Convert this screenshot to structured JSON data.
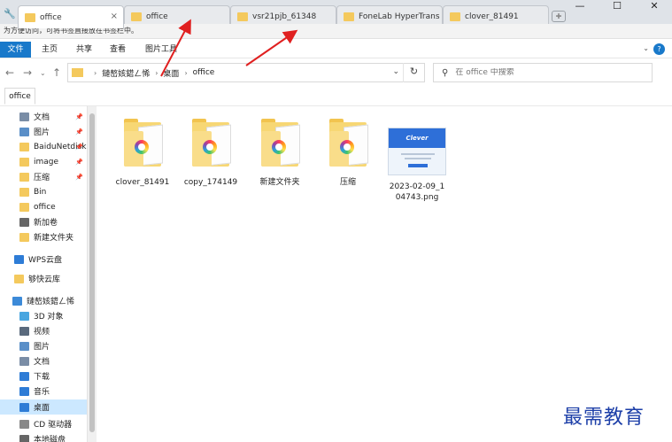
{
  "browser": {
    "tabs": [
      {
        "label": "office",
        "active": true
      },
      {
        "label": "office",
        "active": false
      },
      {
        "label": "vsr21pjb_61348",
        "active": false
      },
      {
        "label": "FoneLab HyperTrans",
        "active": false
      },
      {
        "label": "clover_81491",
        "active": false
      }
    ],
    "close_glyph": "×",
    "window_controls": {
      "minimize": "—",
      "maximize": "☐",
      "close": "✕"
    },
    "bookmark_hint": "为方便访问，可将书签直接放在书签栏中。"
  },
  "ribbon": {
    "file": "文件",
    "menus": [
      "主页",
      "共享",
      "查看",
      "图片工具"
    ],
    "help": "?"
  },
  "address": {
    "crumbs": [
      "鏈嶅姟鍣ㄥ悕",
      "桌面",
      "office"
    ],
    "search_placeholder": "在 office 中搜索"
  },
  "quick_tab": "office",
  "sidebar": [
    {
      "label": "文档",
      "icon": "document-icon",
      "color": "#7a8da6",
      "pinned": true
    },
    {
      "label": "图片",
      "icon": "pictures-icon",
      "color": "#5a8fc8",
      "pinned": true
    },
    {
      "label": "BaiduNetdisk",
      "icon": "folder-icon",
      "color": "#f4c95d",
      "pinned": true
    },
    {
      "label": "image",
      "icon": "folder-icon",
      "color": "#f4c95d",
      "pinned": true
    },
    {
      "label": "压缩",
      "icon": "folder-icon",
      "color": "#f4c95d",
      "pinned": true
    },
    {
      "label": "Bin",
      "icon": "folder-icon",
      "color": "#f4c95d",
      "pinned": false
    },
    {
      "label": "office",
      "icon": "folder-icon",
      "color": "#f4c95d",
      "pinned": false
    },
    {
      "label": "新加卷",
      "icon": "drive-icon",
      "color": "#666666",
      "pinned": false
    },
    {
      "label": "新建文件夹",
      "icon": "folder-icon",
      "color": "#f4c95d",
      "pinned": false
    },
    {
      "label": "WPS云盘",
      "icon": "cloud-icon",
      "color": "#2e7cd6",
      "pinned": false
    },
    {
      "label": "够快云库",
      "icon": "folder-icon",
      "color": "#f4c95d",
      "pinned": false
    },
    {
      "label": "鏈嶅姟鍣ㄥ悕",
      "icon": "computer-icon",
      "color": "#3c8ad8",
      "pinned": false
    },
    {
      "label": "3D 对象",
      "icon": "cube-icon",
      "color": "#49a6e0",
      "pinned": false
    },
    {
      "label": "视频",
      "icon": "video-icon",
      "color": "#5a6a7d",
      "pinned": false
    },
    {
      "label": "图片",
      "icon": "pictures-icon",
      "color": "#5a8fc8",
      "pinned": false
    },
    {
      "label": "文档",
      "icon": "document-icon",
      "color": "#7a8da6",
      "pinned": false
    },
    {
      "label": "下载",
      "icon": "download-icon",
      "color": "#2e7cd6",
      "pinned": false
    },
    {
      "label": "音乐",
      "icon": "music-icon",
      "color": "#2e7cd6",
      "pinned": false
    },
    {
      "label": "桌面",
      "icon": "desktop-icon",
      "color": "#2e7cd6",
      "pinned": false,
      "selected": true
    },
    {
      "label": "CD 驱动器",
      "icon": "cd-icon",
      "color": "#888888",
      "pinned": false
    },
    {
      "label": "本地磁盘",
      "icon": "disk-icon",
      "color": "#666666",
      "pinned": false
    }
  ],
  "files": [
    {
      "name": "clover_81491",
      "type": "folder"
    },
    {
      "name": "copy_174149",
      "type": "folder"
    },
    {
      "name": "新建文件夹",
      "type": "folder"
    },
    {
      "name": "压缩",
      "type": "folder"
    },
    {
      "name": "2023-02-09_104743.png",
      "type": "png",
      "thumb_text": "Clever"
    }
  ],
  "watermark": "最需教育"
}
